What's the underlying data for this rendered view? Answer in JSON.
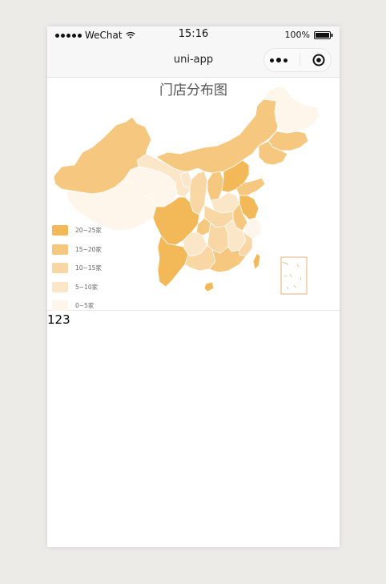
{
  "status_bar": {
    "carrier": "WeChat",
    "time": "15:16",
    "battery": "100%"
  },
  "nav": {
    "title": "uni-app",
    "more_icon": "more-dots-icon",
    "close_icon": "target-circle-icon"
  },
  "chart_data": {
    "type": "map",
    "title": "门店分布图",
    "legend": [
      {
        "label": "20~25家",
        "color": "#f3b959"
      },
      {
        "label": "15~20家",
        "color": "#f5c77f"
      },
      {
        "label": "10~15家",
        "color": "#f8d7a4"
      },
      {
        "label": "5~10家",
        "color": "#fbe6c8"
      },
      {
        "label": "0~5家",
        "color": "#fef6ea"
      }
    ]
  },
  "content": {
    "text": "123"
  },
  "colors": {
    "page_background": "#edebe8",
    "bar_background": "#f7f7f7"
  }
}
